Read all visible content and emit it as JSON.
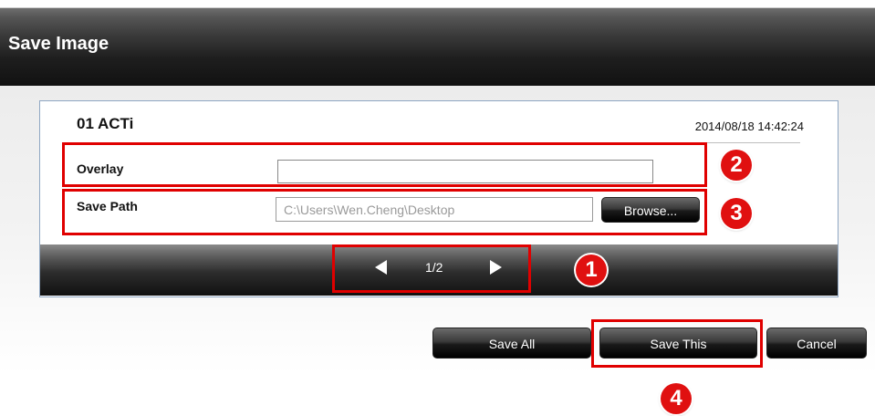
{
  "dialog": {
    "title": "Save Image",
    "camera_name": "01 ACTi",
    "timestamp": "2014/08/18 14:42:24"
  },
  "form": {
    "overlay_label": "Overlay",
    "overlay_value": "",
    "save_path_label": "Save Path",
    "save_path_value": "C:\\Users\\Wen.Cheng\\Desktop",
    "browse_label": "Browse..."
  },
  "navigation": {
    "page_indicator": "1/2"
  },
  "footer": {
    "save_all_label": "Save All",
    "save_this_label": "Save This",
    "cancel_label": "Cancel"
  },
  "annotations": {
    "color": "#e00000",
    "badges": [
      "1",
      "2",
      "3",
      "4"
    ]
  }
}
